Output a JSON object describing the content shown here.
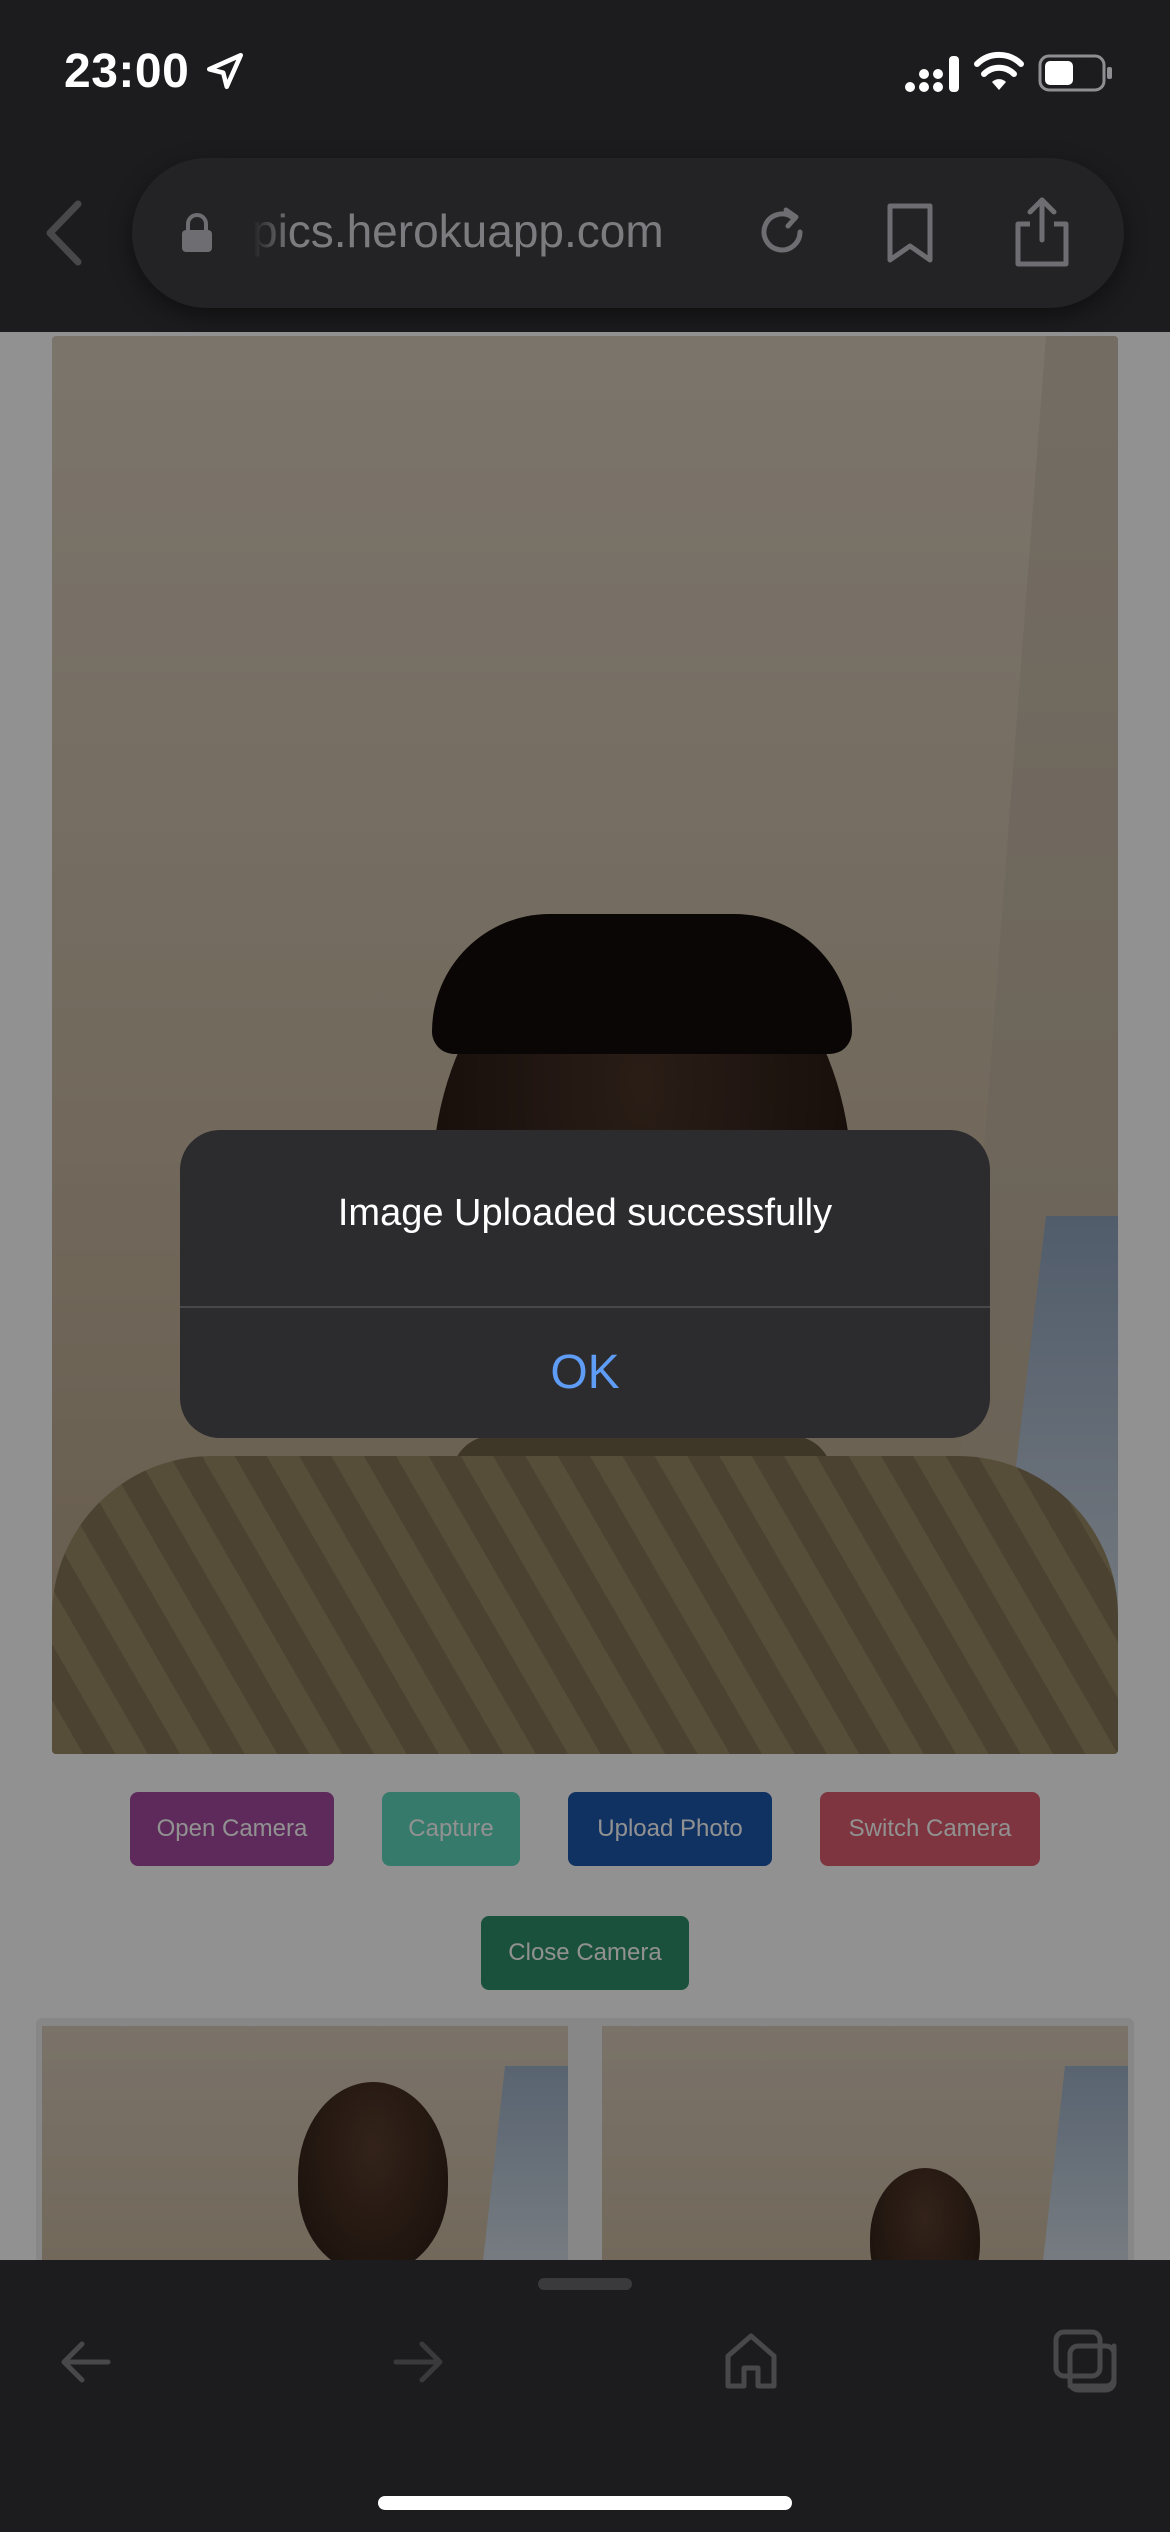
{
  "status_bar": {
    "time": "23:00"
  },
  "browser": {
    "url": "pics.herokuapp.com"
  },
  "buttons": {
    "open_camera": "Open Camera",
    "capture": "Capture",
    "upload_photo": "Upload Photo",
    "switch_camera": "Switch Camera",
    "close_camera": "Close Camera"
  },
  "alert": {
    "message": "Image Uploaded successfully",
    "ok_label": "OK"
  },
  "colors": {
    "alert_button": "#5e9cf5",
    "open_camera": "#a44ba0",
    "capture": "#5fd7bd",
    "upload_photo": "#1c58ad",
    "switch_camera": "#dd5d70",
    "close_camera": "#2f8f6c"
  }
}
